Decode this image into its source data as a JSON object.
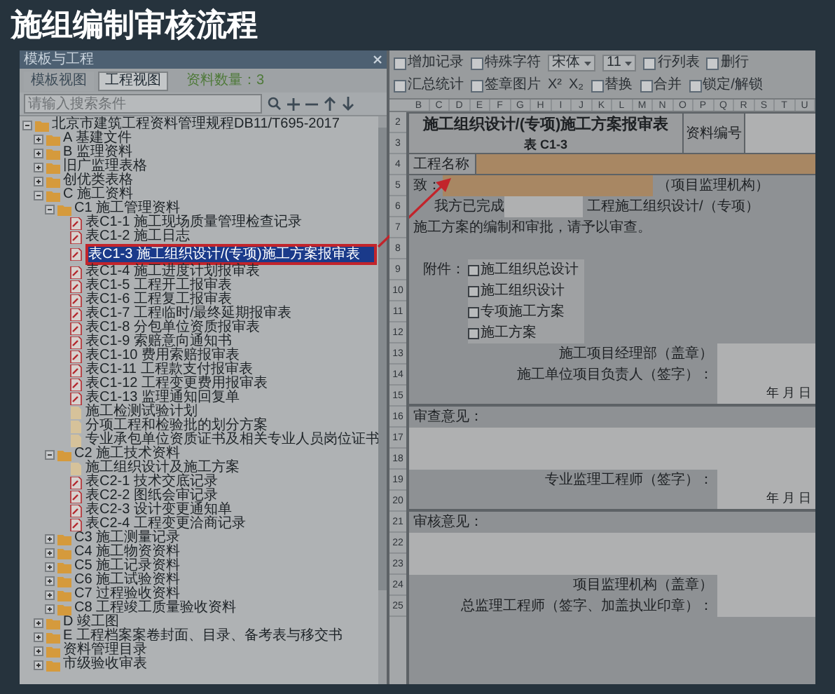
{
  "slide_title": "施组编制审核流程",
  "panel": {
    "title": "模板与工程",
    "tabs": [
      {
        "label": "模板视图",
        "selected": false
      },
      {
        "label": "工程视图",
        "selected": true
      }
    ],
    "count": "资料数量：3",
    "search": {
      "placeholder": "请输入搜索条件"
    },
    "tree": [
      {
        "label": "北京市建筑工程资料管理规程DB11/T695-2017",
        "kind": "folder",
        "expanded": true,
        "selected": false,
        "children": [
          {
            "label": "A 基建文件",
            "kind": "folder",
            "expanded": false,
            "selected": false
          },
          {
            "label": "B 监理资料",
            "kind": "folder",
            "expanded": false,
            "selected": false
          },
          {
            "label": "旧广监理表格",
            "kind": "folder",
            "expanded": false,
            "selected": false
          },
          {
            "label": "创优类表格",
            "kind": "folder",
            "expanded": false,
            "selected": false
          },
          {
            "label": "C 施工资料",
            "kind": "folder",
            "expanded": true,
            "selected": false,
            "children": [
              {
                "label": "C1 施工管理资料",
                "kind": "folder",
                "expanded": true,
                "selected": false,
                "children": [
                  {
                    "label": "表C1-1 施工现场质量管理检查记录",
                    "kind": "form",
                    "selected": false
                  },
                  {
                    "label": "表C1-2 施工日志",
                    "kind": "form",
                    "selected": false
                  },
                  {
                    "label": "表C1-3 施工组织设计/(专项)施工方案报审表",
                    "kind": "form",
                    "selected": true
                  },
                  {
                    "label": "表C1-4 施工进度计划报审表",
                    "kind": "form",
                    "selected": false
                  },
                  {
                    "label": "表C1-5 工程开工报审表",
                    "kind": "form",
                    "selected": false
                  },
                  {
                    "label": "表C1-6 工程复工报审表",
                    "kind": "form",
                    "selected": false
                  },
                  {
                    "label": "表C1-7 工程临时/最终延期报审表",
                    "kind": "form",
                    "selected": false
                  },
                  {
                    "label": "表C1-8 分包单位资质报审表",
                    "kind": "form",
                    "selected": false
                  },
                  {
                    "label": "表C1-9 索赔意向通知书",
                    "kind": "form",
                    "selected": false
                  },
                  {
                    "label": "表C1-10 费用索赔报审表",
                    "kind": "form",
                    "selected": false
                  },
                  {
                    "label": "表C1-11 工程款支付报审表",
                    "kind": "form",
                    "selected": false
                  },
                  {
                    "label": "表C1-12 工程变更费用报审表",
                    "kind": "form",
                    "selected": false
                  },
                  {
                    "label": "表C1-13 监理通知回复单",
                    "kind": "form",
                    "selected": false
                  },
                  {
                    "label": "施工检测试验计划",
                    "kind": "doc",
                    "selected": false
                  },
                  {
                    "label": "分项工程和检验批的划分方案",
                    "kind": "doc",
                    "selected": false
                  },
                  {
                    "label": "专业承包单位资质证书及相关专业人员岗位证书",
                    "kind": "doc",
                    "selected": false
                  }
                ]
              },
              {
                "label": "C2 施工技术资料",
                "kind": "folder",
                "expanded": true,
                "selected": false,
                "children": [
                  {
                    "label": "施工组织设计及施工方案",
                    "kind": "doc",
                    "selected": false
                  },
                  {
                    "label": "表C2-1 技术交底记录",
                    "kind": "form",
                    "selected": false
                  },
                  {
                    "label": "表C2-2 图纸会审记录",
                    "kind": "form",
                    "selected": false
                  },
                  {
                    "label": "表C2-3 设计变更通知单",
                    "kind": "form",
                    "selected": false
                  },
                  {
                    "label": "表C2-4 工程变更洽商记录",
                    "kind": "form",
                    "selected": false
                  }
                ]
              },
              {
                "label": "C3 施工测量记录",
                "kind": "folder",
                "expanded": false,
                "selected": false
              },
              {
                "label": "C4 施工物资资料",
                "kind": "folder",
                "expanded": false,
                "selected": false
              },
              {
                "label": "C5 施工记录资料",
                "kind": "folder",
                "expanded": false,
                "selected": false
              },
              {
                "label": "C6 施工试验资料",
                "kind": "folder",
                "expanded": false,
                "selected": false
              },
              {
                "label": "C7 过程验收资料",
                "kind": "folder",
                "expanded": false,
                "selected": false
              },
              {
                "label": "C8 工程竣工质量验收资料",
                "kind": "folder",
                "expanded": false,
                "selected": false
              }
            ]
          },
          {
            "label": "D 竣工图",
            "kind": "folder",
            "expanded": false,
            "selected": false
          },
          {
            "label": "E 工程档案案卷封面、目录、备考表与移交书",
            "kind": "folder",
            "expanded": false,
            "selected": false
          },
          {
            "label": "资料管理目录",
            "kind": "folder",
            "expanded": false,
            "selected": false
          },
          {
            "label": "市级验收审表",
            "kind": "folder",
            "expanded": false,
            "selected": false
          }
        ]
      }
    ]
  },
  "toolbar": [
    [
      {
        "kind": "button",
        "label": "增加记录"
      },
      {
        "kind": "button",
        "label": "特殊字符"
      },
      {
        "kind": "select",
        "label": "宋体"
      },
      {
        "kind": "select",
        "label": "11"
      },
      {
        "kind": "button",
        "label": "行列表"
      },
      {
        "kind": "button",
        "label": "删行"
      }
    ],
    [
      {
        "kind": "button",
        "label": "汇总统计"
      },
      {
        "kind": "button",
        "label": "签章图片"
      },
      {
        "kind": "glyph",
        "label": "X²"
      },
      {
        "kind": "glyph",
        "label": "X₂"
      },
      {
        "kind": "button",
        "label": "替换"
      },
      {
        "kind": "button",
        "label": "合并"
      },
      {
        "kind": "button",
        "label": "锁定/解锁"
      }
    ]
  ],
  "sheet": {
    "columns": [
      "B",
      "C",
      "D",
      "E",
      "F",
      "G",
      "H",
      "I",
      "J",
      "K",
      "L",
      "M",
      "N",
      "O",
      "P",
      "Q",
      "R",
      "S",
      "T",
      "U"
    ],
    "row_numbers": [
      "2",
      "3",
      "4",
      "5",
      "6",
      "7",
      "8",
      "9",
      "10",
      "11",
      "12",
      "13",
      "14",
      "15",
      "16",
      "17",
      "18",
      "19",
      "20",
      "21",
      "22",
      "23",
      "24",
      "25"
    ],
    "title": "施工组织设计/(专项)施工方案报审表",
    "form_code": "表 C1-3",
    "doc_number_label": "资料编号",
    "project_name_label": "工程名称",
    "to_label": "致：",
    "to_suffix": "（项目监理机构）",
    "completed_label": "我方已完成",
    "completed_suffix": "工程施工组织设计/（专项）",
    "request_text": "施工方案的编制和审批，请予以审查。",
    "attachments_label": "附件：",
    "attachments": [
      {
        "label": "施工组织总设计",
        "checked": false
      },
      {
        "label": "施工组织设计",
        "checked": false
      },
      {
        "label": "专项施工方案",
        "checked": false
      },
      {
        "label": "施工方案",
        "checked": false
      }
    ],
    "contractor_seal": "施工项目经理部（盖章）",
    "contractor_sign": "施工单位项目负责人（签字）：",
    "date_1": "年 月 日",
    "review_label": "审查意见：",
    "engineer_sign": "专业监理工程师（签字）：",
    "date_2": "年 月 日",
    "audit_label": "审核意见：",
    "supervisor_seal": "项目监理机构（盖章）",
    "chief_sign": "总监理工程师（签字、加盖执业印章）："
  }
}
